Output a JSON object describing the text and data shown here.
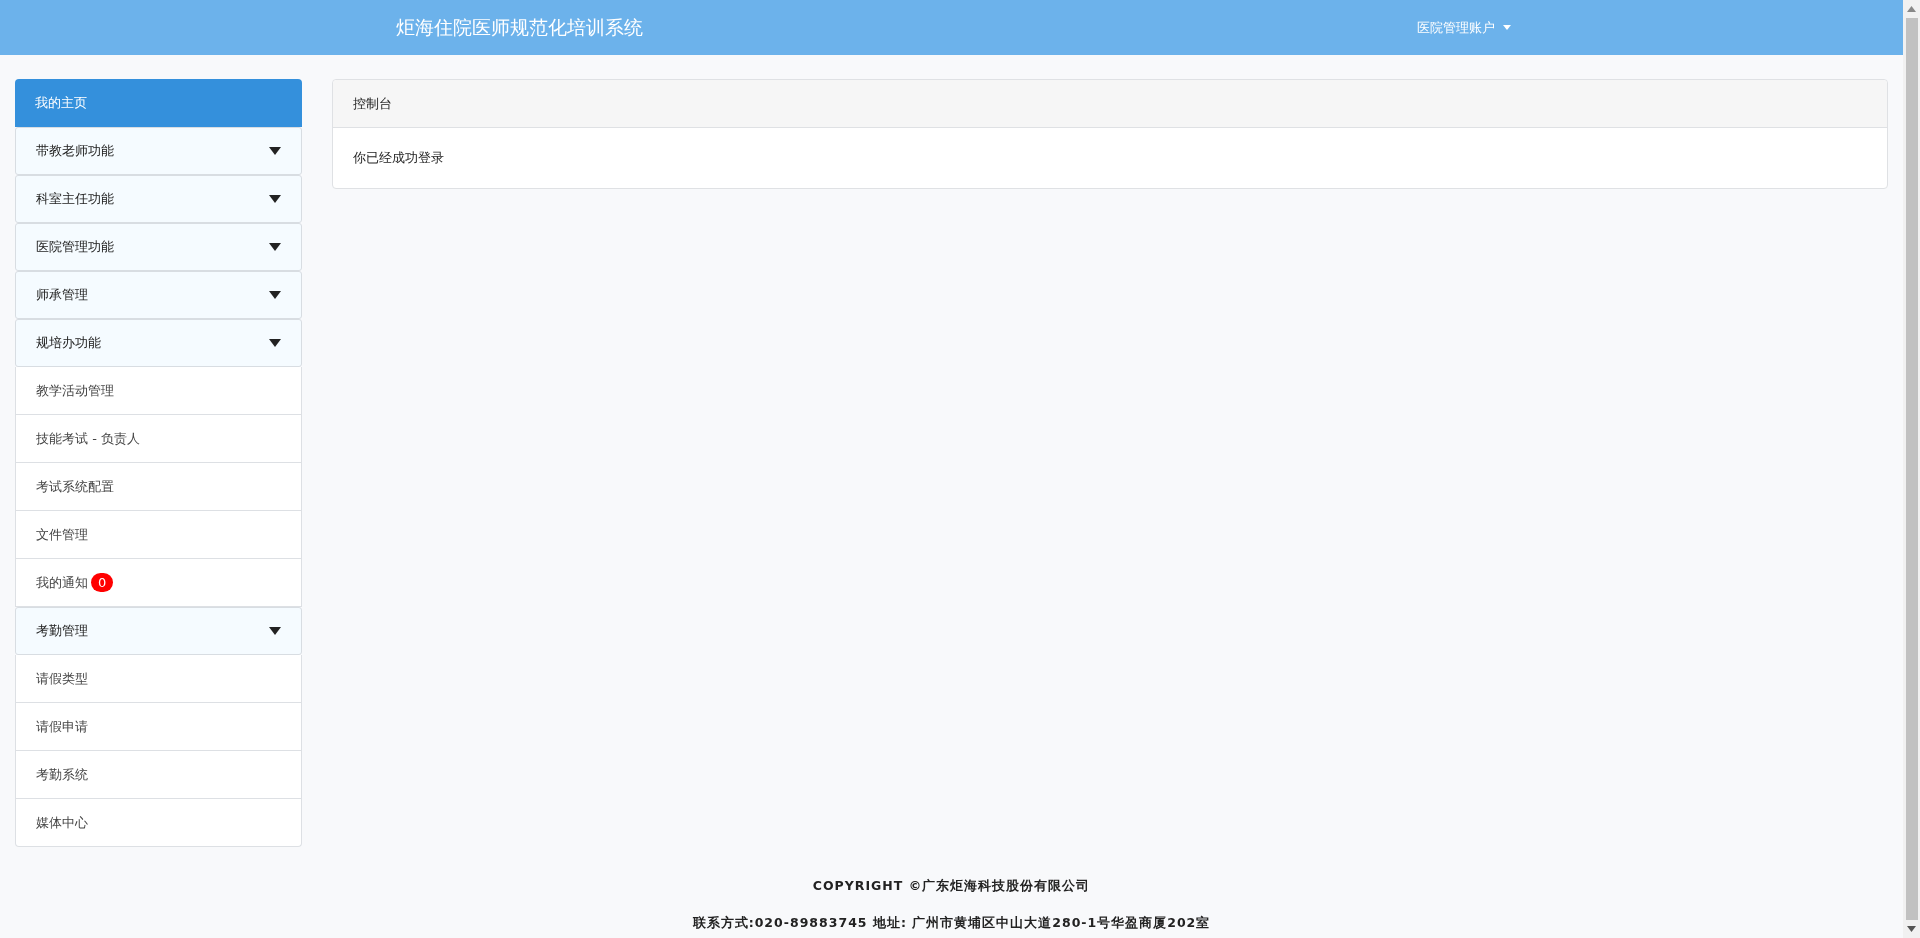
{
  "header": {
    "title": "炬海住院医师规范化培训系统",
    "account": "医院管理账户"
  },
  "sidebar": {
    "items": [
      {
        "label": "我的主页",
        "kind": "link",
        "selected": true
      },
      {
        "label": "带教老师功能",
        "kind": "group",
        "selected": false
      },
      {
        "label": "科室主任功能",
        "kind": "group",
        "selected": false
      },
      {
        "label": "医院管理功能",
        "kind": "group",
        "selected": false
      },
      {
        "label": "师承管理",
        "kind": "group",
        "selected": false
      },
      {
        "label": "规培办功能",
        "kind": "group",
        "selected": false
      },
      {
        "label": "教学活动管理",
        "kind": "link",
        "selected": false
      },
      {
        "label": "技能考试 - 负责人",
        "kind": "link",
        "selected": false
      },
      {
        "label": "考试系统配置",
        "kind": "link",
        "selected": false
      },
      {
        "label": "文件管理",
        "kind": "link",
        "selected": false
      },
      {
        "label": "我的通知",
        "kind": "link",
        "selected": false,
        "badge": "0"
      },
      {
        "label": "考勤管理",
        "kind": "group",
        "selected": false
      },
      {
        "label": "请假类型",
        "kind": "link",
        "selected": false
      },
      {
        "label": "请假申请",
        "kind": "link",
        "selected": false
      },
      {
        "label": "考勤系统",
        "kind": "link",
        "selected": false
      },
      {
        "label": "媒体中心",
        "kind": "link",
        "selected": false
      }
    ]
  },
  "panel": {
    "title": "控制台",
    "message": "你已经成功登录"
  },
  "footer": {
    "copyright": "COPYRIGHT ©广东炬海科技股份有限公司",
    "contact": "联系方式:020-89883745 地址: 广州市黄埔区中山大道280-1号华盈商厦202室"
  }
}
